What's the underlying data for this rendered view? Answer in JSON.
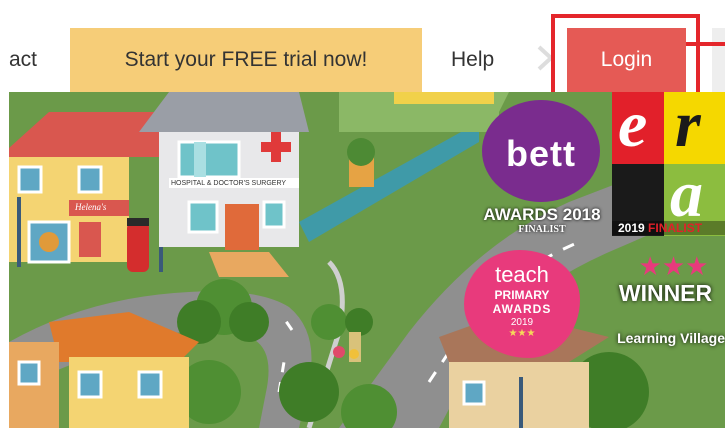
{
  "nav": {
    "contact_label": "act",
    "trial_label": "Start your FREE trial now!",
    "help_label": "Help",
    "login_label": "Login"
  },
  "colors": {
    "trial_bg": "#f6cd78",
    "login_bg": "#e55a55",
    "highlight": "#e4262b"
  },
  "awards": {
    "bett": {
      "logo": "bett",
      "title": "AWARDS 2018",
      "subtitle": "FINALIST"
    },
    "era": {
      "letters": [
        "e",
        "r",
        "a"
      ],
      "year": "2019",
      "status": "FINALIST"
    },
    "teach": {
      "line1": "teach",
      "line2": "PRIMARY",
      "line3": "AWARDS",
      "line4": "2019",
      "stars": "★★★"
    },
    "winner": {
      "stars": "★★★",
      "title": "WINNER",
      "subtitle": "Learning Village"
    }
  },
  "scene": {
    "hospital_sign": "HOSPITAL & DOCTOR'S SURGERY",
    "shop_sign": "Helena's"
  }
}
